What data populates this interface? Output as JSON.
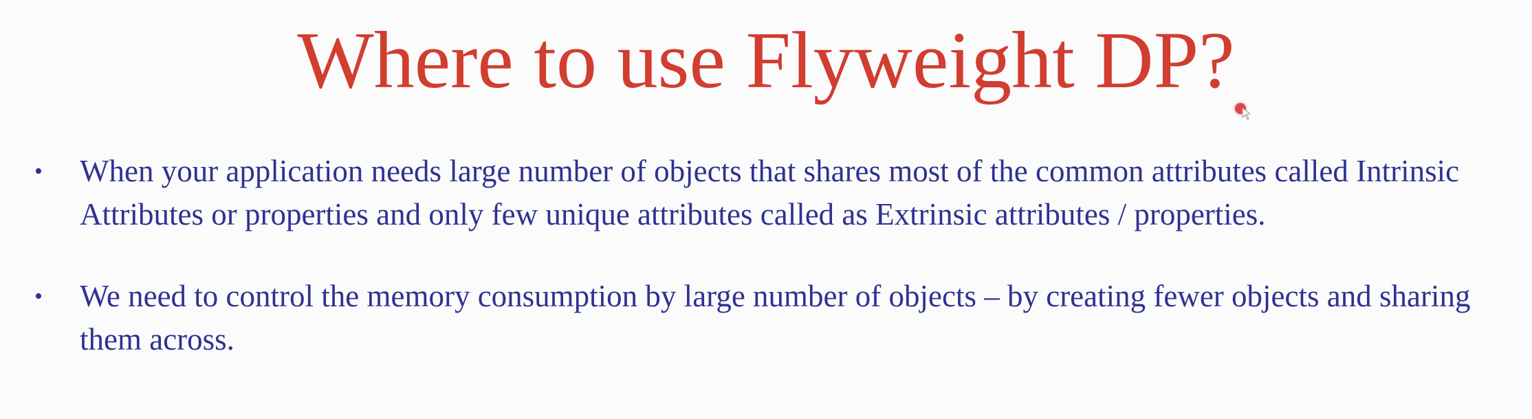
{
  "slide": {
    "title": "Where to use Flyweight DP?",
    "bullet_glyph": "•",
    "bullets": [
      "When your application needs large number of objects that shares most of the common attributes called Intrinsic Attributes or properties and only few unique attributes called as Extrinsic attributes / properties.",
      "We need to control the memory consumption by large number of objects – by creating fewer objects and sharing them across."
    ]
  },
  "colors": {
    "title": "#d13d2f",
    "body_text": "#2e3291",
    "background": "#fbfbfb",
    "pointer": "#e0454a"
  },
  "icons": {
    "pointer": "laser-pointer-icon"
  }
}
